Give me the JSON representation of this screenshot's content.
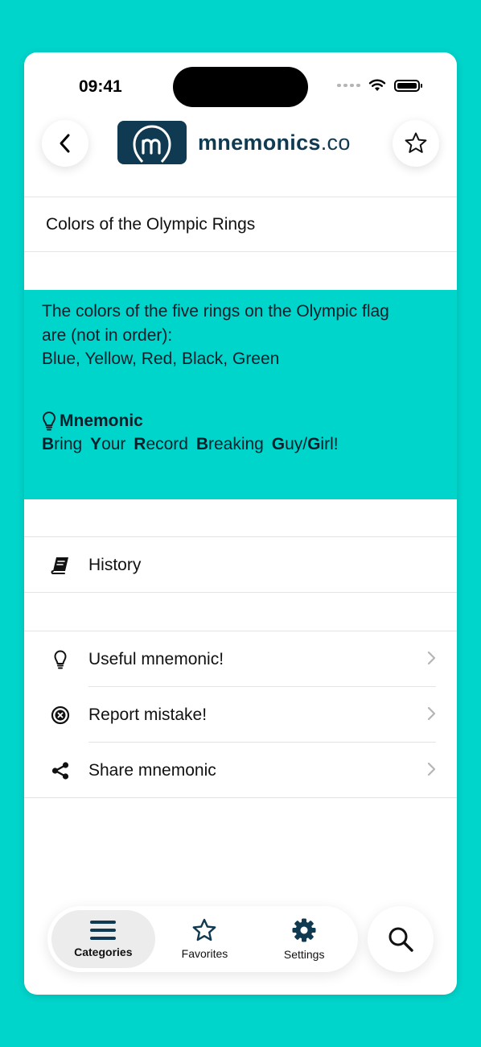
{
  "status": {
    "time": "09:41"
  },
  "header": {
    "logo_brand": "mnemonics",
    "logo_suffix": ".co",
    "back_icon": "chevron-left-icon",
    "favorite_icon": "star-outline-icon"
  },
  "card": {
    "title": "Colors of the Olympic Rings",
    "description_lines": [
      "The colors of the five rings on the Olympic flag",
      "are (not in order):",
      "Blue, Yellow, Red, Black, Green"
    ],
    "mnemonic_heading": "Mnemonic",
    "mnemonic_words": [
      {
        "first": "B",
        "rest": "ring"
      },
      {
        "first": "Y",
        "rest": "our"
      },
      {
        "first": "R",
        "rest": "ecord"
      },
      {
        "first": "B",
        "rest": "reaking"
      },
      {
        "first": "G",
        "rest": "uy/"
      },
      {
        "first": "G",
        "rest": "irl!"
      }
    ]
  },
  "history": {
    "label": "History",
    "icon": "book-icon"
  },
  "actions": [
    {
      "label": "Useful mnemonic!",
      "icon": "lightbulb-icon"
    },
    {
      "label": "Report mistake!",
      "icon": "circle-x-icon"
    },
    {
      "label": "Share mnemonic",
      "icon": "share-icon"
    }
  ],
  "tabbar": {
    "tabs": [
      {
        "label": "Categories",
        "icon": "menu-icon",
        "active": true
      },
      {
        "label": "Favorites",
        "icon": "star-icon",
        "active": false
      },
      {
        "label": "Settings",
        "icon": "gear-icon",
        "active": false
      }
    ],
    "search_icon": "search-icon"
  },
  "colors": {
    "accent": "#00D5CC",
    "brand": "#0f3a52"
  }
}
